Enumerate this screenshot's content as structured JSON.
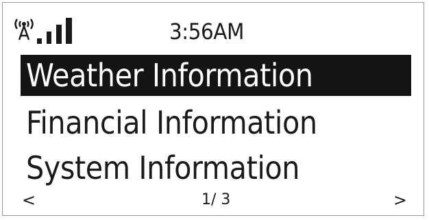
{
  "status": {
    "time": "3:56AM",
    "wifi_icon": "antenna-icon",
    "signal_icon": "signal-bars-icon",
    "signal_level": 0.75
  },
  "menu": {
    "items": [
      {
        "label": "Weather Information",
        "selected": true
      },
      {
        "label": "Financial Information",
        "selected": false
      },
      {
        "label": "System Information",
        "selected": false
      }
    ]
  },
  "footer": {
    "prev": "<",
    "page": "1/ 3",
    "next": ">"
  },
  "colors": {
    "selection_bg": "#141414",
    "text": "#1a1a1a",
    "background": "#ffffff"
  }
}
